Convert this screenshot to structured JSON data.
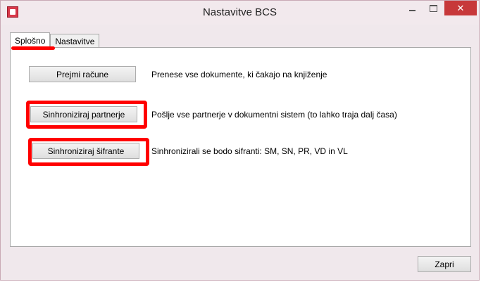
{
  "window": {
    "title": "Nastavitve BCS",
    "close_glyph": "✕"
  },
  "tabs": [
    {
      "label": "Splošno",
      "active": true
    },
    {
      "label": "Nastavitve",
      "active": false
    }
  ],
  "actions": [
    {
      "button": "Prejmi račune",
      "description": "Prenese vse dokumente, ki čakajo na knjiženje",
      "highlighted": false
    },
    {
      "button": "Sinhroniziraj partnerje",
      "description": "Pošlje vse partnerje v dokumentni sistem (to lahko traja dalj časa)",
      "highlighted": true
    },
    {
      "button": "Sinhroniziraj šifrante",
      "description": "Sinhronizirali se bodo sifranti: SM, SN, PR, VD in VL",
      "highlighted": true
    }
  ],
  "footer": {
    "close_label": "Zapri"
  },
  "colors": {
    "highlight": "#ff0000",
    "close_button": "#c7383a"
  }
}
